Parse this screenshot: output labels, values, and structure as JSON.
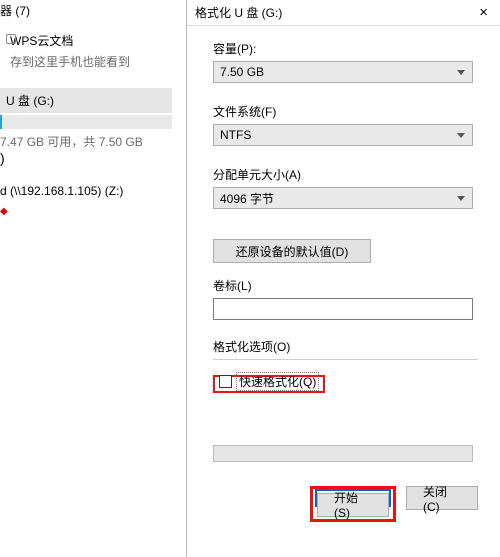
{
  "left": {
    "header": "器 (7)",
    "wps_name": "WPS云文档",
    "wps_sub": "存到这里手机也能看到",
    "udisk_name": "U 盘 (G:)",
    "udisk_info": "7.47 GB 可用，共 7.50 GB",
    "paren": ")",
    "net_drive": "d (\\\\192.168.1.105) (Z:)"
  },
  "dialog": {
    "title": "格式化 U 盘 (G:)",
    "close": "×",
    "capacity_label": "容量(P):",
    "capacity_value": "7.50 GB",
    "fs_label": "文件系统(F)",
    "fs_value": "NTFS",
    "au_label": "分配单元大小(A)",
    "au_value": "4096 字节",
    "restore_label": "还原设备的默认值(D)",
    "vol_label": "卷标(L)",
    "vol_value": "",
    "group_label": "格式化选项(O)",
    "quick_label": "快速格式化(Q)",
    "start_label": "开始(S)",
    "close_label": "关闭(C)"
  }
}
